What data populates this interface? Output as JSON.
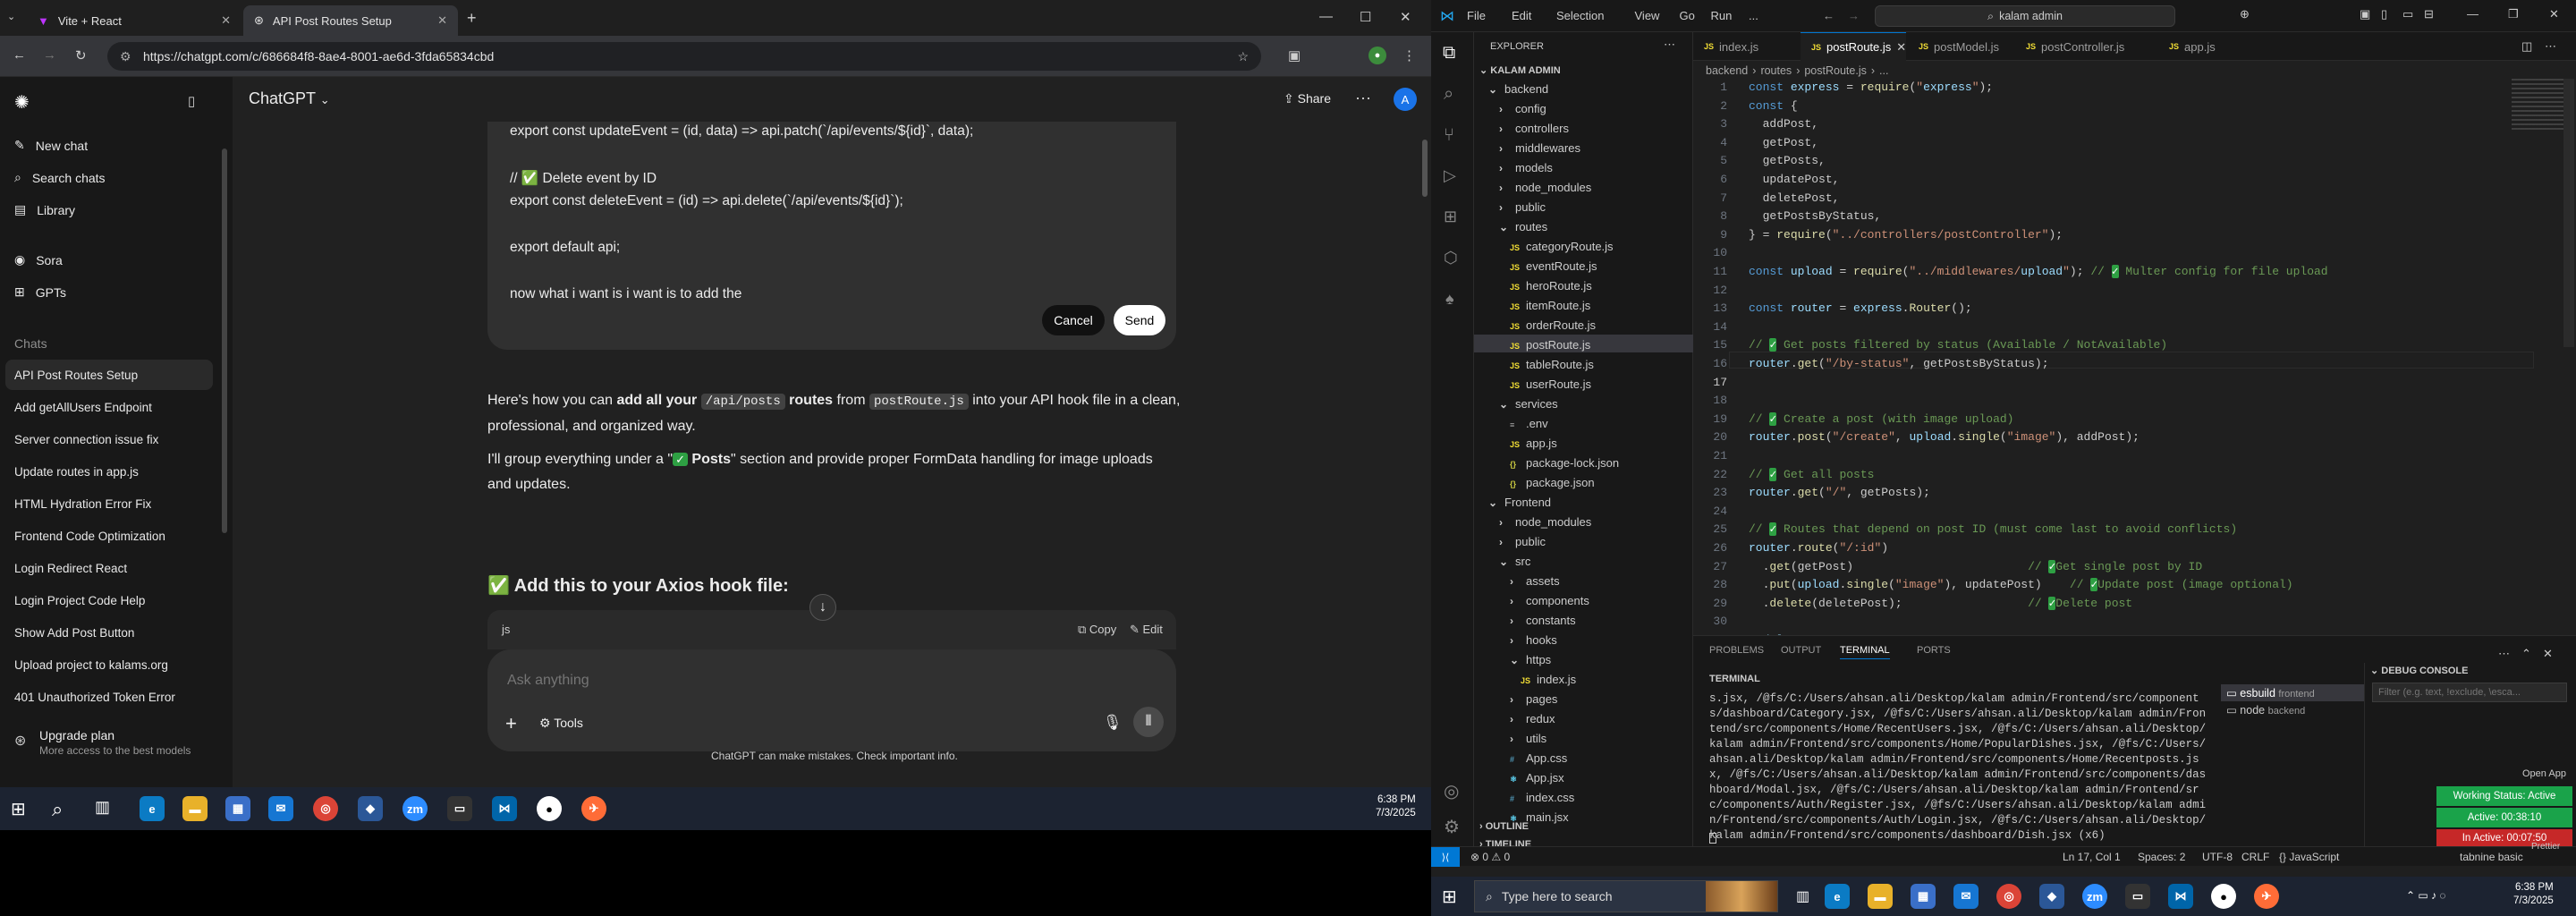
{
  "chrome": {
    "tabs": [
      "Vite + React",
      "API Post Routes Setup"
    ],
    "url": "https://chatgpt.com/c/686684f8-8ae4-8001-ae6d-3fda65834cbd",
    "title": "ChatGPT",
    "share": "Share",
    "avatar": "A",
    "sidebar": {
      "top_items": [
        "New chat",
        "Search chats",
        "Library",
        "Sora",
        "GPTs"
      ],
      "chats_heading": "Chats",
      "chats": [
        "API Post Routes Setup",
        "Add getAllUsers Endpoint",
        "Server connection issue fix",
        "Update routes in app.js",
        "HTML Hydration Error Fix",
        "Frontend Code Optimization",
        "Login Redirect React",
        "Login Project Code Help",
        "Show Add Post Button",
        "Upload project to kalams.org",
        "401 Unauthorized Token Error"
      ],
      "upgrade_title": "Upgrade plan",
      "upgrade_sub": "More access to the best models"
    },
    "editbox_lines": [
      "export const updateEvent = (id, data) => api.patch(`/api/events/${id}`, data);",
      "",
      "// ✅ Delete event by ID",
      "export const deleteEvent = (id) => api.delete(`/api/events/${id}`);",
      "",
      "export default api;",
      "",
      "now what i want is i want is to add the"
    ],
    "cancel": "Cancel",
    "send": "Send",
    "para1_a": "Here's how you can ",
    "para1_b": "add all your ",
    "para1_code1": "/api/posts",
    "para1_c": " routes",
    "para1_d": " from ",
    "para1_code2": "postRoute.js",
    "para1_e": " into your API hook file in a clean,",
    "para1_f": "professional, and organized way.",
    "para2_a": "I'll group everything under a \"",
    "para2_b": " Posts",
    "para2_c": "\" section and provide proper FormData handling for image uploads",
    "para2_d": "and updates.",
    "section_heading": "✅ Add this to your Axios hook file:",
    "code_lang": "js",
    "copy": "Copy",
    "edit": "Edit",
    "placeholder": "Ask anything",
    "tools": "Tools",
    "disclaimer": "ChatGPT can make mistakes. Check important info.",
    "clock_time": "6:38 PM",
    "clock_date": "7/3/2025"
  },
  "vscode": {
    "menu": [
      "File",
      "Edit",
      "Selection",
      "View",
      "Go",
      "Run",
      "..."
    ],
    "search": "kalam admin",
    "explorer_title": "EXPLORER",
    "root": "KALAM ADMIN",
    "tree": [
      {
        "t": "backend",
        "d": 1,
        "k": "open"
      },
      {
        "t": "config",
        "d": 2,
        "k": "closed"
      },
      {
        "t": "controllers",
        "d": 2,
        "k": "closed"
      },
      {
        "t": "middlewares",
        "d": 2,
        "k": "closed"
      },
      {
        "t": "models",
        "d": 2,
        "k": "closed"
      },
      {
        "t": "node_modules",
        "d": 2,
        "k": "closed"
      },
      {
        "t": "public",
        "d": 2,
        "k": "closed"
      },
      {
        "t": "routes",
        "d": 2,
        "k": "open"
      },
      {
        "t": "categoryRoute.js",
        "d": 3,
        "k": "js"
      },
      {
        "t": "eventRoute.js",
        "d": 3,
        "k": "js"
      },
      {
        "t": "heroRoute.js",
        "d": 3,
        "k": "js"
      },
      {
        "t": "itemRoute.js",
        "d": 3,
        "k": "js"
      },
      {
        "t": "orderRoute.js",
        "d": 3,
        "k": "js"
      },
      {
        "t": "postRoute.js",
        "d": 3,
        "k": "js"
      },
      {
        "t": "tableRoute.js",
        "d": 3,
        "k": "js"
      },
      {
        "t": "userRoute.js",
        "d": 3,
        "k": "js"
      },
      {
        "t": "services",
        "d": 2,
        "k": "open"
      },
      {
        "t": ".env",
        "d": 3,
        "k": "file"
      },
      {
        "t": "app.js",
        "d": 3,
        "k": "js"
      },
      {
        "t": "package-lock.json",
        "d": 3,
        "k": "json"
      },
      {
        "t": "package.json",
        "d": 3,
        "k": "json"
      },
      {
        "t": "Frontend",
        "d": 1,
        "k": "open"
      },
      {
        "t": "node_modules",
        "d": 2,
        "k": "closed"
      },
      {
        "t": "public",
        "d": 2,
        "k": "closed"
      },
      {
        "t": "src",
        "d": 2,
        "k": "open"
      },
      {
        "t": "assets",
        "d": 3,
        "k": "closed"
      },
      {
        "t": "components",
        "d": 3,
        "k": "closed"
      },
      {
        "t": "constants",
        "d": 3,
        "k": "closed"
      },
      {
        "t": "hooks",
        "d": 3,
        "k": "closed"
      },
      {
        "t": "https",
        "d": 3,
        "k": "open"
      },
      {
        "t": "index.js",
        "d": 4,
        "k": "js"
      },
      {
        "t": "pages",
        "d": 3,
        "k": "closed"
      },
      {
        "t": "redux",
        "d": 3,
        "k": "closed"
      },
      {
        "t": "utils",
        "d": 3,
        "k": "closed"
      },
      {
        "t": "App.css",
        "d": 3,
        "k": "css"
      },
      {
        "t": "App.jsx",
        "d": 3,
        "k": "jsx"
      },
      {
        "t": "index.css",
        "d": 3,
        "k": "css"
      },
      {
        "t": "main.jsx",
        "d": 3,
        "k": "jsx"
      }
    ],
    "outline": "OUTLINE",
    "timeline": "TIMELINE",
    "tabs": [
      "index.js",
      "postRoute.js",
      "postModel.js",
      "postController.js",
      "app.js"
    ],
    "breadcrumb": [
      "backend",
      "routes",
      "postRoute.js",
      "..."
    ],
    "code": [
      "const express = require(\"express\");",
      "const {",
      "  addPost,",
      "  getPost,",
      "  getPosts,",
      "  updatePost,",
      "  deletePost,",
      "  getPostsByStatus,",
      "} = require(\"../controllers/postController\");",
      "",
      "const upload = require(\"../middlewares/upload\"); // ✅ Multer config for file upload",
      "",
      "const router = express.Router();",
      "",
      "// ✅ Get posts filtered by status (Available / NotAvailable)",
      "router.get(\"/by-status\", getPostsByStatus);",
      "",
      "",
      "// ✅ Create a post (with image upload)",
      "router.post(\"/create\", upload.single(\"image\"), addPost);",
      "",
      "// ✅ Get all posts",
      "router.get(\"/\", getPosts);",
      "",
      "// ✅ Routes that depend on post ID (must come last to avoid conflicts)",
      "router.route(\"/:id\")",
      "  .get(getPost)                         // ✅Get single post by ID",
      "  .put(upload.single(\"image\"), updatePost)    // ✅Update post (image optional)",
      "  .delete(deletePost);                  // ✅Delete post",
      "",
      "module.exports = router;",
      ""
    ],
    "panel_tabs": [
      "PROBLEMS",
      "OUTPUT",
      "TERMINAL",
      "PORTS"
    ],
    "terminal_label": "TERMINAL",
    "terminal_text": "s.jsx, /@fs/C:/Users/ahsan.ali/Desktop/kalam admin/Frontend/src/components/dashboard/Category.jsx, /@fs/C:/Users/ahsan.ali/Desktop/kalam admin/Frontend/src/components/Home/RecentUsers.jsx, /@fs/C:/Users/ahsan.ali/Desktop/kalam admin/Frontend/src/components/Home/PopularDishes.jsx, /@fs/C:/Users/ahsan.ali/Desktop/kalam admin/Frontend/src/components/Home/Recentposts.jsx, /@fs/C:/Users/ahsan.ali/Desktop/kalam admin/Frontend/src/components/dashboard/Modal.jsx, /@fs/C:/Users/ahsan.ali/Desktop/kalam admin/Frontend/src/components/Auth/Register.jsx, /@fs/C:/Users/ahsan.ali/Desktop/kalam admin/Frontend/src/components/Auth/Login.jsx, /@fs/C:/Users/ahsan.ali/Desktop/kalam admin/Frontend/src/components/dashboard/Dish.jsx (x6)",
    "terminals": [
      {
        "name": "esbuild",
        "sub": "frontend"
      },
      {
        "name": "node",
        "sub": "backend"
      }
    ],
    "debug_console": "DEBUG CONSOLE",
    "filter_placeholder": "Filter (e.g. text, !exclude, \\esca...",
    "open_app": "Open App",
    "working_status": "Working Status: Active",
    "active": "Active: 00:38:10",
    "inactive": "In Active: 00:07:50",
    "status": {
      "errors": "0",
      "warnings": "0",
      "pos": "Ln 17, Col 1",
      "spaces": "Spaces: 2",
      "enc": "UTF-8",
      "eol": "CRLF",
      "lang": "JavaScript",
      "tabnine": "tabnine basic",
      "prettier": "Prettier"
    },
    "taskbar_search": "Type here to search",
    "clock_time": "6:38 PM",
    "clock_date": "7/3/2025"
  },
  "colors": {
    "accent": "#0078d4",
    "working": "#1aa34a",
    "inactive": "#c62828",
    "check": "#2ea043"
  }
}
